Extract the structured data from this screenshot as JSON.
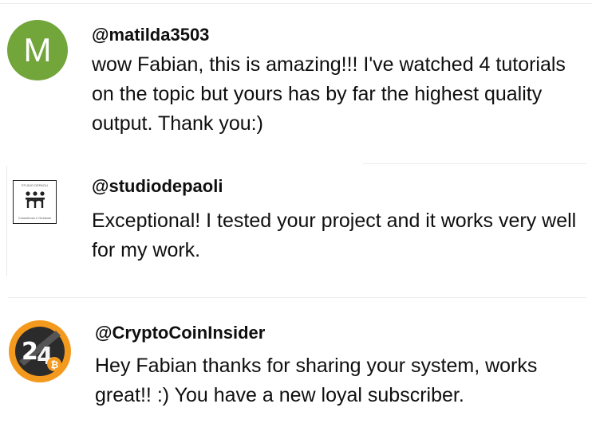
{
  "comments": [
    {
      "avatar_letter": "M",
      "avatar_color": "#72a53a",
      "handle": "@matilda3503",
      "text": "wow Fabian, this is amazing!!! I've watched 4 tutorials on the topic but yours has by far the highest quality output. Thank you:)"
    },
    {
      "avatar_caption_top": "STUDIO DEPAOLI",
      "avatar_caption_bottom": "Consulenza e Gestione",
      "handle": "@studiodepaoli",
      "text": "Exceptional! I tested your project and it works very well for my work."
    },
    {
      "avatar_icon": "bitcoin-24-logo",
      "avatar_color": "#f39a1e",
      "handle": "@CryptoCoinInsider",
      "text": "Hey Fabian thanks for sharing your system, works great!! :) You have a new loyal subscriber."
    }
  ]
}
